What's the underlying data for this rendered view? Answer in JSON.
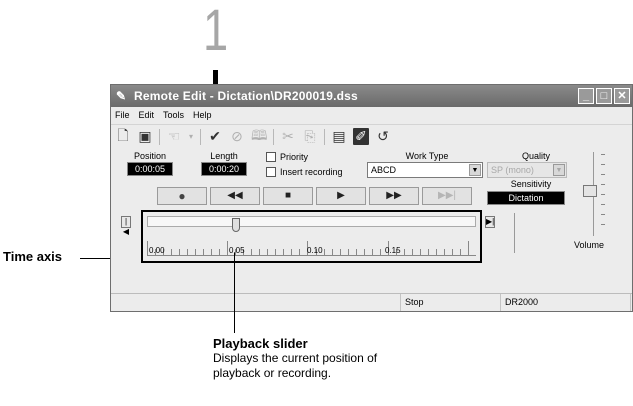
{
  "callout_number": "1",
  "window": {
    "title": "Remote Edit - Dictation\\DR200019.dss",
    "controls": [
      "_",
      "□",
      "X"
    ]
  },
  "menu": [
    "File",
    "Edit",
    "Tools",
    "Help"
  ],
  "toolbar_icons": [
    "new-icon",
    "save-icon",
    "hand-icon",
    "check-icon",
    "cancel-icon",
    "book-icon",
    "cut-icon",
    "paste-icon",
    "properties-icon",
    "edit-icon",
    "undo-icon"
  ],
  "position": {
    "label": "Position",
    "value": "0:00:05"
  },
  "length": {
    "label": "Length",
    "value": "0:00:20"
  },
  "priority_label": "Priority",
  "insert_label": "Insert recording",
  "work_type": {
    "label": "Work Type",
    "value": "ABCD"
  },
  "quality": {
    "label": "Quality",
    "value": "SP (mono)"
  },
  "sensitivity": {
    "label": "Sensitivity",
    "value": "Dictation"
  },
  "volume_label": "Volume",
  "time_axis": {
    "ticks": [
      "0.00",
      "0.05",
      "0.10",
      "0.15"
    ],
    "position_fraction": 0.25
  },
  "status": {
    "state": "Stop",
    "device": "DR2000"
  },
  "annotations": {
    "time_axis": "Time axis",
    "slider_title": "Playback slider",
    "slider_desc": "Displays the current position of playback or recording."
  }
}
